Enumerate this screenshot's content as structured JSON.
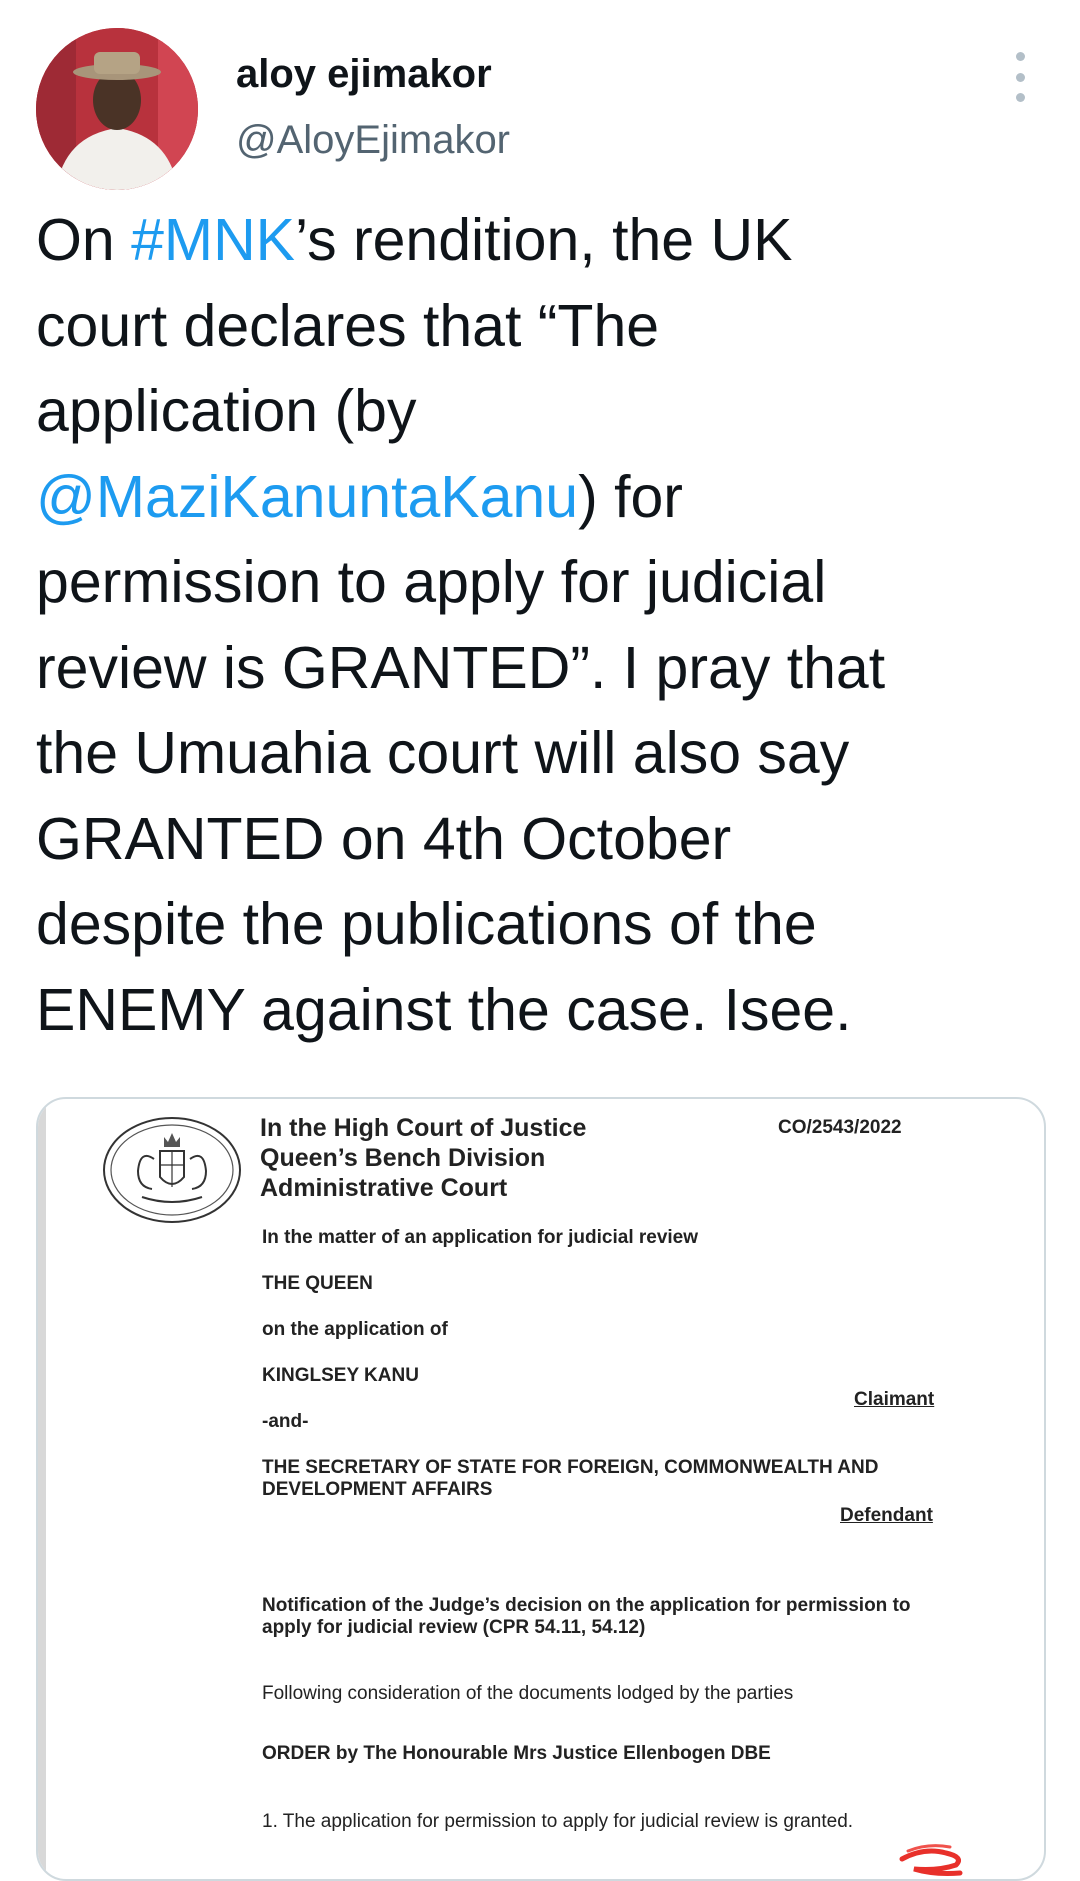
{
  "user": {
    "display_name": "aloy ejimakor",
    "handle": "@AloyEjimakor"
  },
  "more_icon": "more-vertical-icon",
  "tweet": {
    "lines": [
      [
        {
          "t": "On "
        },
        {
          "t": "#MNK",
          "link": true
        },
        {
          "t": "’s rendition, the UK"
        }
      ],
      [
        {
          "t": "court declares that “The"
        }
      ],
      [
        {
          "t": "application (by"
        }
      ],
      [
        {
          "t": "@MaziKanuntaKanu",
          "link": true
        },
        {
          "t": ") for"
        }
      ],
      [
        {
          "t": "permission to apply for judicial"
        }
      ],
      [
        {
          "t": "review is GRANTED”. I pray that"
        }
      ],
      [
        {
          "t": "the Umuahia court will also say"
        }
      ],
      [
        {
          "t": "GRANTED on 4th October"
        }
      ],
      [
        {
          "t": "despite the publications of the"
        }
      ],
      [
        {
          "t": "ENEMY against the case. Isee."
        }
      ]
    ],
    "link_color": "#1d9bf0"
  },
  "document": {
    "court_lines": [
      "In the High Court of Justice",
      "Queen’s Bench Division",
      "Administrative Court"
    ],
    "case_number": "CO/2543/2022",
    "matter": "In the matter of an application for judicial review",
    "queen": "THE QUEEN",
    "on_application": "on the application of",
    "claimant_name": "KINGLSEY KANU",
    "claimant_label": "Claimant",
    "and": "-and-",
    "defendant_line1": "THE SECRETARY OF STATE FOR FOREIGN, COMMONWEALTH AND",
    "defendant_line2": "DEVELOPMENT AFFAIRS",
    "defendant_label": "Defendant",
    "notification_line1": "Notification of the Judge’s decision on the application for permission to",
    "notification_line2": "apply for judicial review (CPR 54.11, 54.12)",
    "consideration": "Following consideration of the documents lodged by the parties",
    "order": "ORDER by The Honourable Mrs Justice Ellenbogen DBE",
    "point1": "1.  The application for permission to apply for judicial review is granted."
  }
}
